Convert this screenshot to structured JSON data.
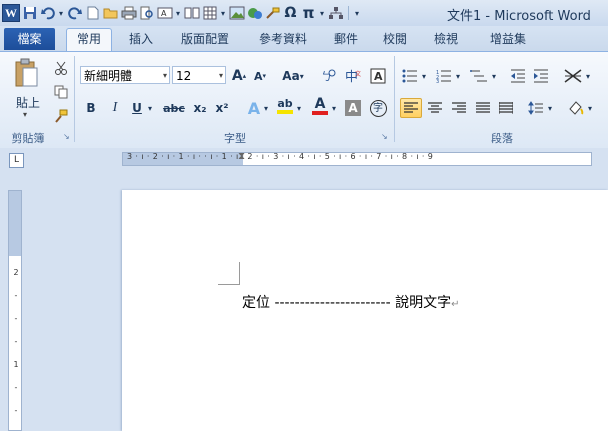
{
  "window": {
    "title": "文件1 - Microsoft Word"
  },
  "quick_access": [
    {
      "icon": "save-icon"
    },
    {
      "icon": "undo-icon"
    },
    {
      "icon": "redo-icon"
    },
    {
      "icon": "new-document-icon"
    },
    {
      "icon": "open-folder-icon"
    },
    {
      "icon": "print-icon"
    },
    {
      "icon": "print-preview-icon"
    },
    {
      "icon": "text-box-icon"
    },
    {
      "icon": "book-icon"
    },
    {
      "icon": "table-icon"
    },
    {
      "icon": "picture-icon"
    },
    {
      "icon": "clip-art-icon"
    },
    {
      "icon": "format-painter-icon"
    },
    {
      "icon": "symbol-icon",
      "label": "Ω"
    },
    {
      "icon": "equation-icon",
      "label": "π"
    },
    {
      "icon": "smartart-icon"
    }
  ],
  "tabs": {
    "file": "檔案",
    "items": [
      {
        "label": "常用",
        "active": true
      },
      {
        "label": "插入"
      },
      {
        "label": "版面配置"
      },
      {
        "label": "參考資料"
      },
      {
        "label": "郵件"
      },
      {
        "label": "校閱"
      },
      {
        "label": "檢視"
      },
      {
        "label": "增益集"
      }
    ]
  },
  "ribbon": {
    "clipboard": {
      "label": "剪貼簿",
      "paste": "貼上"
    },
    "font": {
      "label": "字型",
      "font_name": "新細明體",
      "font_size": "12",
      "grow": "A",
      "shrink": "A",
      "case": "Aa",
      "bold": "B",
      "italic": "I",
      "underline": "U",
      "strikethrough": "abc",
      "subscript": "x₂",
      "superscript": "x²",
      "text_effect": "A",
      "highlight": "ab",
      "font_color": "A",
      "char_shading": "A",
      "enclose": "字"
    },
    "paragraph": {
      "label": "段落"
    }
  },
  "ruler": {
    "h_numbers": "3 · ı · 2 · ı · 1 · ı ·   · ı · 1 · ı · 2 · ı · 3 · ı · 4 · ı · 5 · ı · 6 · ı · 7 · ı · 8 · ı · 9",
    "v_numbers": [
      "2",
      "-",
      "-",
      "-",
      "1",
      "-",
      "-",
      "-",
      "3"
    ],
    "tab_selector": "L"
  },
  "document": {
    "text": "定位 ----------------------- 說明文字",
    "pilcrow": "↵"
  },
  "colors": {
    "file_tab": "#2b62b4",
    "ribbon_bg": "#dde8f5",
    "active_button": "#ffd061",
    "underline_red": "#e02020",
    "highlight_yellow": "#f5e400"
  }
}
